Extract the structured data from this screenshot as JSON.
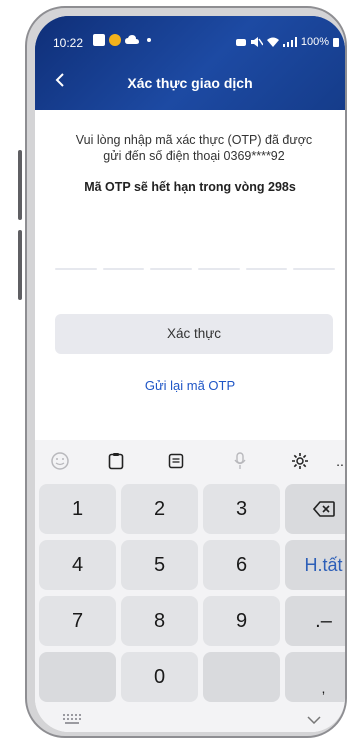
{
  "status": {
    "time": "10:22",
    "battery": "100%"
  },
  "header": {
    "title": "Xác thực giao dịch"
  },
  "otp": {
    "line1": "Vui lòng nhập mã xác thực (OTP) đã được",
    "line2": "gửi đến số điện thoại  0369****92",
    "expire": "Mã OTP sẽ hết hạn trong vòng  298s"
  },
  "actions": {
    "confirm_label": "Xác thực",
    "resend_label": "Gửi lại mã OTP"
  },
  "keyboard": {
    "keys": {
      "k1": "1",
      "k2": "2",
      "k3": "3",
      "k4": "4",
      "k5": "5",
      "k6": "6",
      "done": "H.tất",
      "k7": "7",
      "k8": "8",
      "k9": "9",
      "sym": ".–",
      "k0": "0",
      "comma": ","
    },
    "toolbar_more": "..."
  },
  "colors": {
    "appbar": "#173e8f",
    "link": "#1f56c6"
  }
}
